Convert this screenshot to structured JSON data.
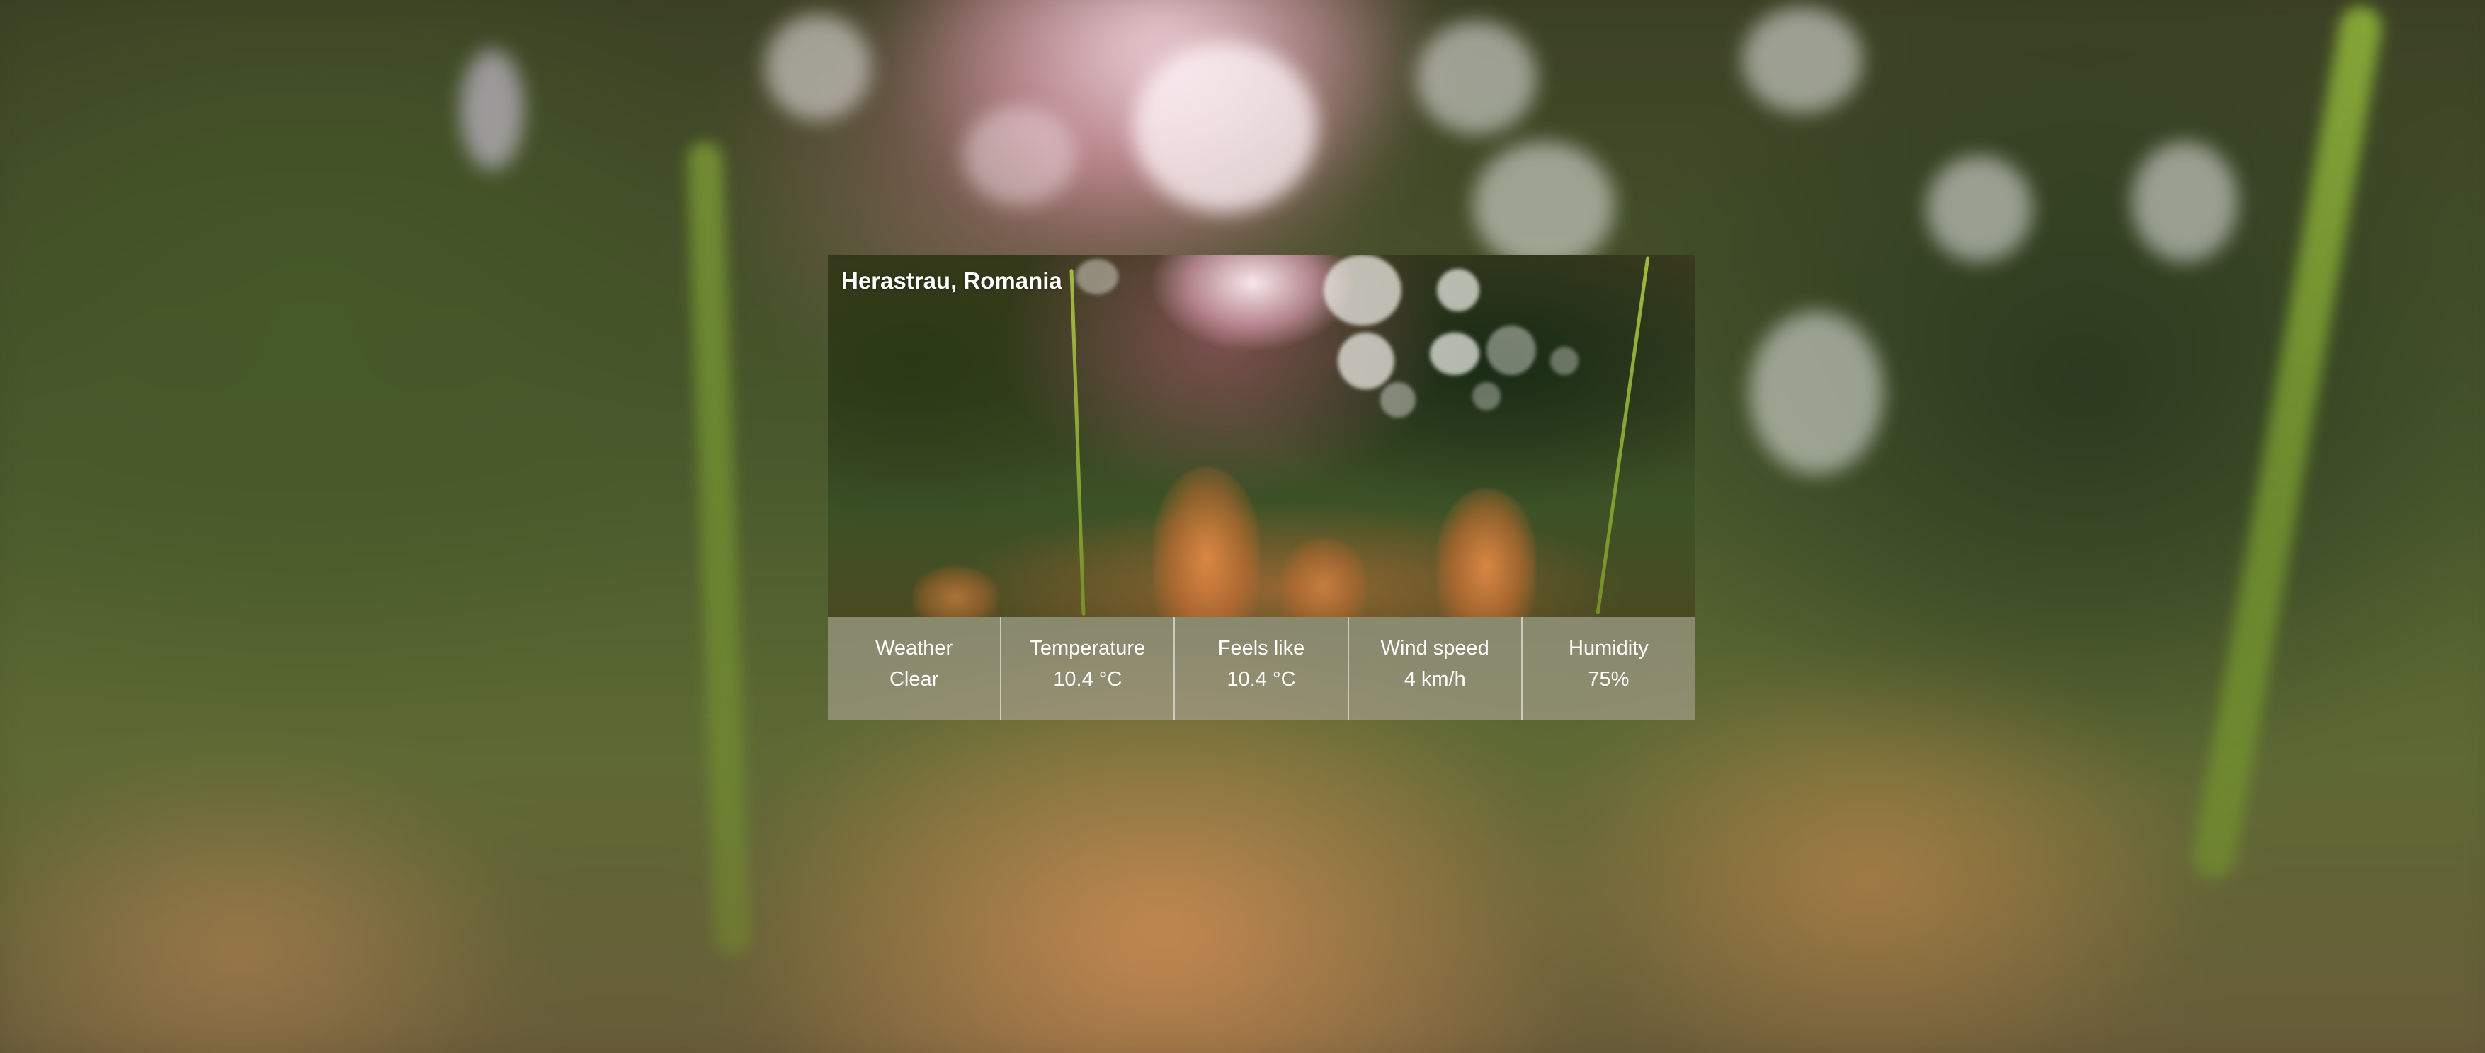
{
  "location": "Herastrau, Romania",
  "stats": [
    {
      "label": "Weather",
      "value": "Clear"
    },
    {
      "label": "Temperature",
      "value": "10.4 °C"
    },
    {
      "label": "Feels like",
      "value": "10.4 °C"
    },
    {
      "label": "Wind speed",
      "value": "4 km/h"
    },
    {
      "label": "Humidity",
      "value": "75%"
    }
  ],
  "colors": {
    "text": "#ffffff",
    "stats_panel": "rgba(180,170,160,0.55)"
  },
  "images": [
    "background-meadow-photo",
    "card-meadow-photo"
  ]
}
